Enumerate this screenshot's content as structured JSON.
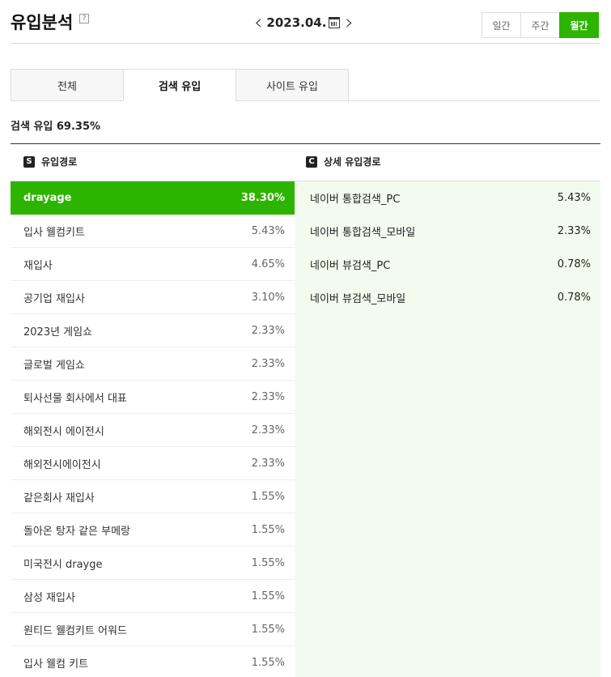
{
  "header": {
    "title": "유입분석",
    "help": "?",
    "date": "2023.04.",
    "periods": [
      "일간",
      "주간",
      "월간"
    ],
    "active_period": "월간"
  },
  "tabs": [
    "전체",
    "검색 유입",
    "사이트 유입"
  ],
  "active_tab": "검색 유입",
  "summary": "검색 유입 69.35%",
  "columns": {
    "left_badge": "S",
    "left_title": "유입경로",
    "right_badge": "C",
    "right_title": "상세 유입경로"
  },
  "keywords": [
    {
      "label": "drayage",
      "value": "38.30%"
    },
    {
      "label": "입사 웰컴키트",
      "value": "5.43%"
    },
    {
      "label": "재입사",
      "value": "4.65%"
    },
    {
      "label": "공기업 재입사",
      "value": "3.10%"
    },
    {
      "label": "2023년 게임쇼",
      "value": "2.33%"
    },
    {
      "label": "글로벌 게임쇼",
      "value": "2.33%"
    },
    {
      "label": "퇴사선물 회사에서 대표",
      "value": "2.33%"
    },
    {
      "label": "해외전시 에이전시",
      "value": "2.33%"
    },
    {
      "label": "해외전시에이전시",
      "value": "2.33%"
    },
    {
      "label": "같은회사 재입사",
      "value": "1.55%"
    },
    {
      "label": "돌아온 탕자 같은 부메랑",
      "value": "1.55%"
    },
    {
      "label": "미국전시 drayge",
      "value": "1.55%"
    },
    {
      "label": "삼성 재입사",
      "value": "1.55%"
    },
    {
      "label": "원티드 웰컴키트 어워드",
      "value": "1.55%"
    },
    {
      "label": "입사 웰컴 키트",
      "value": "1.55%"
    }
  ],
  "details": [
    {
      "label": "네이버 통합검색_PC",
      "value": "5.43%"
    },
    {
      "label": "네이버 통합검색_모바일",
      "value": "2.33%"
    },
    {
      "label": "네이버 뷰검색_PC",
      "value": "0.78%"
    },
    {
      "label": "네이버 뷰검색_모바일",
      "value": "0.78%"
    }
  ],
  "colors": {
    "accent": "#2db400",
    "detail_bg": "#f3fbef"
  }
}
